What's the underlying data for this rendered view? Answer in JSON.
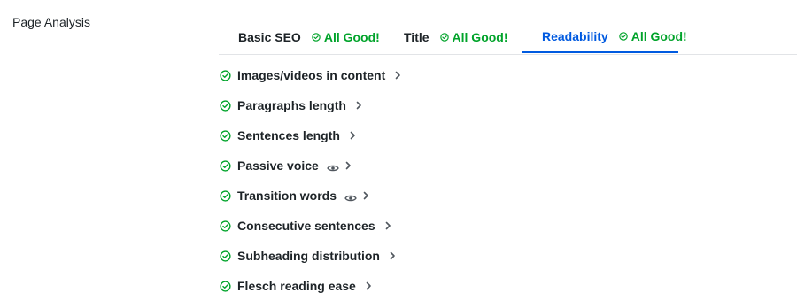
{
  "section": {
    "label": "Page Analysis"
  },
  "tabs": [
    {
      "label": "Basic SEO",
      "status": "All Good!",
      "active": false
    },
    {
      "label": "Title",
      "status": "All Good!",
      "active": false
    },
    {
      "label": "Readability",
      "status": "All Good!",
      "active": true
    }
  ],
  "checks": [
    {
      "label": "Images/videos in content",
      "status": "passed",
      "has_eye": false
    },
    {
      "label": "Paragraphs length",
      "status": "passed",
      "has_eye": false
    },
    {
      "label": "Sentences length",
      "status": "passed",
      "has_eye": false
    },
    {
      "label": "Passive voice",
      "status": "passed",
      "has_eye": true
    },
    {
      "label": "Transition words",
      "status": "passed",
      "has_eye": true
    },
    {
      "label": "Consecutive sentences",
      "status": "passed",
      "has_eye": false
    },
    {
      "label": "Subheading distribution",
      "status": "passed",
      "has_eye": false
    },
    {
      "label": "Flesch reading ease",
      "status": "passed",
      "has_eye": false
    }
  ],
  "colors": {
    "success": "#00a32a",
    "accent": "#005ae0",
    "text": "#1d2327"
  },
  "icons": {
    "status": "check-circle-icon",
    "preview": "eye-icon",
    "expand": "chevron-right-icon"
  }
}
